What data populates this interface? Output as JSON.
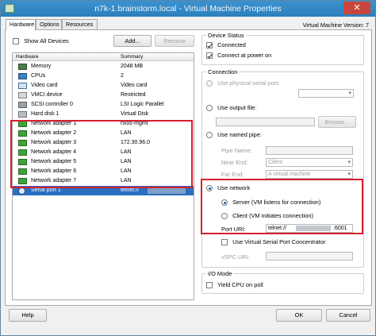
{
  "window": {
    "title": "n7k-1.brainstorm.local - Virtual Machine Properties",
    "close_glyph": "✕",
    "version_label": "Virtual Machine Version: 7"
  },
  "tabs": [
    {
      "label": "Hardware",
      "active": true
    },
    {
      "label": "Options",
      "active": false
    },
    {
      "label": "Resources",
      "active": false
    }
  ],
  "hardware": {
    "show_all_label": "Show All Devices",
    "show_all_checked": false,
    "add_label": "Add...",
    "remove_label": "Remove",
    "col_hardware": "Hardware",
    "col_summary": "Summary",
    "rows": [
      {
        "name": "Memory",
        "summary": "2048 MB",
        "icon": "memory-icon"
      },
      {
        "name": "CPUs",
        "summary": "2",
        "icon": "cpu-icon"
      },
      {
        "name": "Video card",
        "summary": "Video card",
        "icon": "video-card-icon"
      },
      {
        "name": "VMCI device",
        "summary": "Restricted",
        "icon": "vmci-icon"
      },
      {
        "name": "SCSI controller 0",
        "summary": "LSI Logic Parallel",
        "icon": "scsi-icon"
      },
      {
        "name": "Hard disk 1",
        "summary": "Virtual Disk",
        "icon": "hard-disk-icon"
      },
      {
        "name": "Network adapter 1",
        "summary": "nxos-mgmt",
        "icon": "network-adapter-icon"
      },
      {
        "name": "Network adapter 2",
        "summary": "LAN",
        "icon": "network-adapter-icon"
      },
      {
        "name": "Network adapter 3",
        "summary": "172.30.96.0",
        "icon": "network-adapter-icon"
      },
      {
        "name": "Network adapter 4",
        "summary": "LAN",
        "icon": "network-adapter-icon"
      },
      {
        "name": "Network adapter 5",
        "summary": "LAN",
        "icon": "network-adapter-icon"
      },
      {
        "name": "Network adapter 6",
        "summary": "LAN",
        "icon": "network-adapter-icon"
      },
      {
        "name": "Network adapter 7",
        "summary": "LAN",
        "icon": "network-adapter-icon"
      },
      {
        "name": "Serial port 1",
        "summary": "telnet://",
        "icon": "serial-port-icon",
        "selected": true
      }
    ]
  },
  "device_status": {
    "title": "Device Status",
    "connected_label": "Connected",
    "connected_checked": true,
    "poweron_label": "Connect at power on",
    "poweron_checked": true
  },
  "connection": {
    "title": "Connection",
    "physical_label": "Use physical serial port:",
    "output_file_label": "Use output file:",
    "browse_label": "Browse...",
    "named_pipe_label": "Use named pipe:",
    "pipe_name_label": "Pipe Name:",
    "near_end_label": "Near End:",
    "near_end_value": "Client",
    "far_end_label": "Far End:",
    "far_end_value": "A virtual machine",
    "use_network_label": "Use network",
    "server_label": "Server  (VM listens for connection)",
    "client_label": "Client  (VM initiates connection)",
    "port_uri_label": "Port URI:",
    "port_uri_prefix": "telnet://",
    "port_uri_suffix": ":6001",
    "vspc_label": "Use Virtual Serial Port Concentrator",
    "vspc_uri_label": "vSPC URI:"
  },
  "io_mode": {
    "title": "I/O Mode",
    "yield_label": "Yield CPU on poll"
  },
  "footer": {
    "help_label": "Help",
    "ok_label": "OK",
    "cancel_label": "Cancel"
  },
  "colors": {
    "highlight_box": "#d4202f",
    "selection": "#2a6fbf",
    "titlebar": "#2b7fbd"
  }
}
